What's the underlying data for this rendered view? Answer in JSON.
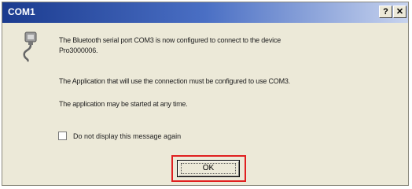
{
  "window": {
    "title": "COM1",
    "help_button": "?",
    "close_button": "✕"
  },
  "message": {
    "line1": "The Bluetooth serial port COM3 is now configured to connect to the device",
    "line1b": "Pro3000006.",
    "line2": "The Application that will use the connection must be configured to use COM3.",
    "line3": "The application may be started at any time."
  },
  "checkbox": {
    "label": "Do not display this message again",
    "checked": false
  },
  "ok_button": {
    "label": "OK"
  },
  "colors": {
    "titlebar": "#1b3b8f",
    "dialog_bg": "#ece9d8",
    "highlight": "#e02020"
  },
  "icons": {
    "message_icon": "serial-port-cable-icon"
  }
}
